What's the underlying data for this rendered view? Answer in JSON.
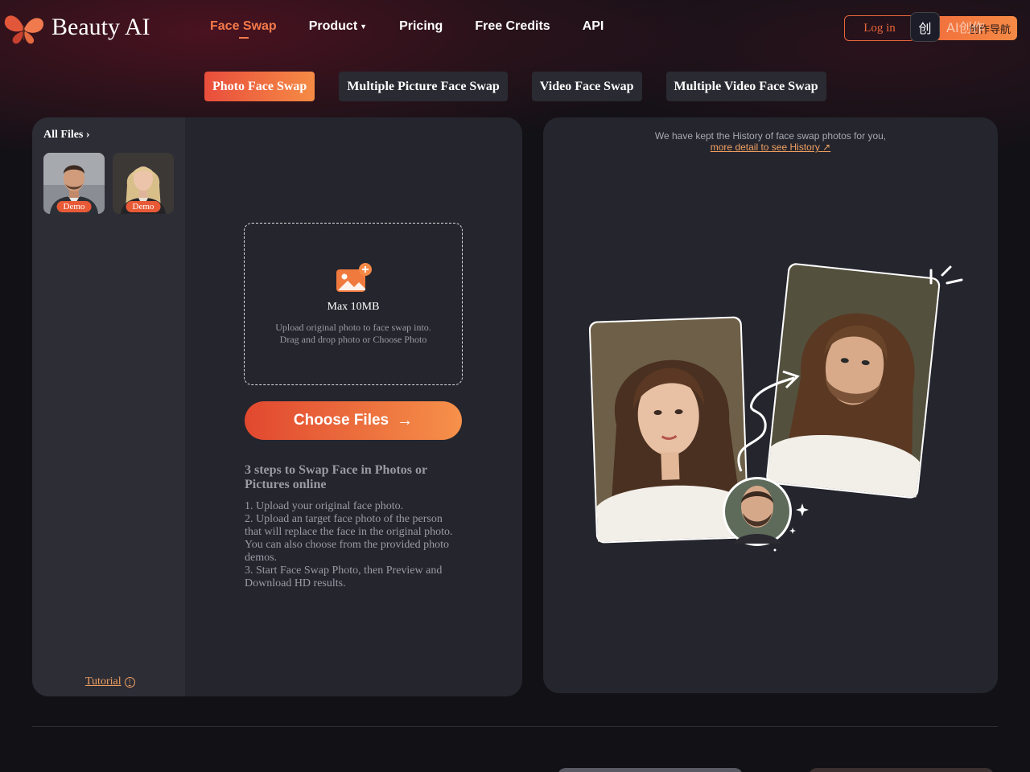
{
  "header": {
    "brand": "Beauty AI",
    "nav": [
      {
        "label": "Face Swap",
        "active": true
      },
      {
        "label": "Product",
        "has_dropdown": true
      },
      {
        "label": "Pricing"
      },
      {
        "label": "Free Credits"
      },
      {
        "label": "API"
      }
    ],
    "login_label": "Log in",
    "cta_label": "创作导航",
    "overlay_text": "AI创作"
  },
  "tabs": [
    {
      "label": "Photo Face Swap",
      "active": true
    },
    {
      "label": "Multiple Picture Face Swap"
    },
    {
      "label": "Video Face Swap"
    },
    {
      "label": "Multiple Video Face Swap"
    }
  ],
  "files": {
    "title": "All Files",
    "demos": [
      {
        "badge": "Demo"
      },
      {
        "badge": "Demo"
      }
    ],
    "tutorial_label": "Tutorial"
  },
  "upload": {
    "max_size": "Max 10MB",
    "hint_line1": "Upload original photo to face swap into.",
    "hint_line2": "Drag and drop photo or Choose Photo",
    "button_label": "Choose Files"
  },
  "steps": {
    "title": "3 steps to Swap Face in Photos or Pictures online",
    "items": [
      "1. Upload your original face photo.",
      "2. Upload an target face photo of the person that will replace the face in the original photo. You can also choose from the provided photo demos.",
      "3. Start Face Swap Photo, then Preview and Download HD results."
    ]
  },
  "history": {
    "note": "We have kept the History of face swap photos for you,",
    "link": "more detail to see History ↗"
  },
  "colors": {
    "accent": "#f47a4a",
    "panel": "#25252e",
    "background": "#111116"
  }
}
